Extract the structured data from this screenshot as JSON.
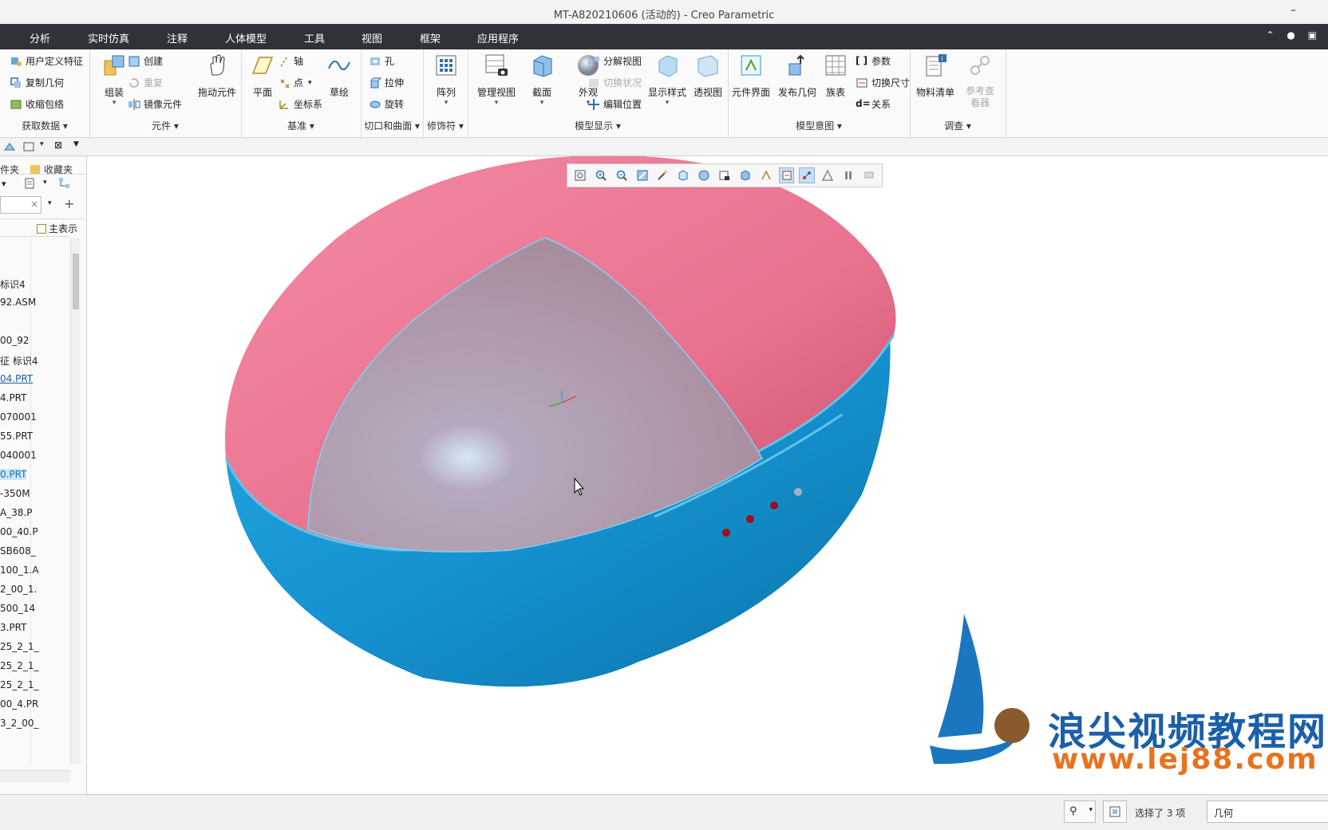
{
  "window": {
    "title": "MT-A820210606 (活动的) - Creo Parametric",
    "minimize": "–"
  },
  "menu": {
    "tabs": [
      "分析",
      "实时仿真",
      "注释",
      "人体模型",
      "工具",
      "视图",
      "框架",
      "应用程序"
    ],
    "right_icons": "⌃ ● ▣"
  },
  "ribbon": {
    "get_data": {
      "label": "获取数据",
      "items": [
        "用户定义特征",
        "复制几何",
        "收缩包络"
      ]
    },
    "components": {
      "label": "元件",
      "assemble": "组装",
      "create": "创建",
      "repeat": "重复",
      "mirror": "镜像元件",
      "drag": "拖动元件"
    },
    "datum": {
      "label": "基准",
      "plane": "平面",
      "axis": "轴",
      "point": "点",
      "csys": "坐标系",
      "sketch": "草绘"
    },
    "cut_surface": {
      "label": "切口和曲面",
      "hole": "孔",
      "extrude": "拉伸",
      "revolve": "旋转"
    },
    "modifiers": {
      "label": "修饰符",
      "pattern": "阵列"
    },
    "model_display": {
      "label": "模型显示",
      "manage_views": "管理视图",
      "section": "截面",
      "appearance": "外观",
      "explode": "分解视图",
      "toggle_status": "切换状况",
      "edit_position": "编辑位置",
      "display_style": "显示样式",
      "perspective": "透视图"
    },
    "model_intent": {
      "label": "模型意图",
      "component_interface": "元件界面",
      "publish_geometry": "发布几何",
      "family_table": "族表",
      "parameters": "参数",
      "switch_dims": "切换尺寸",
      "relations": "关系"
    },
    "investigate": {
      "label": "调查",
      "bom": "物料清单",
      "ref_viewer": "参考查看器"
    }
  },
  "left_panel": {
    "tabs": [
      "件夹",
      "收藏夹"
    ],
    "show_label": "主表示",
    "tree_items": [
      {
        "text": "标识4",
        "style": "normal"
      },
      {
        "text": "92.ASM",
        "style": "normal"
      },
      {
        "text": "00_92",
        "style": "normal"
      },
      {
        "text": "征 标识4",
        "style": "normal"
      },
      {
        "text": "04.PRT",
        "style": "link"
      },
      {
        "text": "4.PRT",
        "style": "normal"
      },
      {
        "text": "070001",
        "style": "normal"
      },
      {
        "text": "55.PRT",
        "style": "normal"
      },
      {
        "text": "040001",
        "style": "normal"
      },
      {
        "text": "0.PRT",
        "style": "sel"
      },
      {
        "text": "-350M",
        "style": "normal"
      },
      {
        "text": "A_38.P",
        "style": "normal"
      },
      {
        "text": "00_40.P",
        "style": "normal"
      },
      {
        "text": "SB608_",
        "style": "normal"
      },
      {
        "text": "100_1.A",
        "style": "normal"
      },
      {
        "text": "2_00_1.",
        "style": "normal"
      },
      {
        "text": "500_14",
        "style": "normal"
      },
      {
        "text": "3.PRT",
        "style": "normal"
      },
      {
        "text": "25_2_1_",
        "style": "normal"
      },
      {
        "text": "25_2_1_",
        "style": "normal"
      },
      {
        "text": "25_2_1_",
        "style": "normal"
      },
      {
        "text": "00_4.PR",
        "style": "normal"
      },
      {
        "text": "3_2_00_",
        "style": "normal"
      }
    ]
  },
  "status": {
    "selected": "选择了 3 项",
    "filter": "几何"
  },
  "watermark": {
    "name": "浪尖视频教程网",
    "url": "www.lej88.com"
  },
  "colors": {
    "menu_bg": "#2f3338",
    "shell_top": "#f07f9c",
    "shell_bottom": "#1a94d1",
    "inner_dome": "#b49aa8",
    "accent": "#1b5fa8"
  }
}
